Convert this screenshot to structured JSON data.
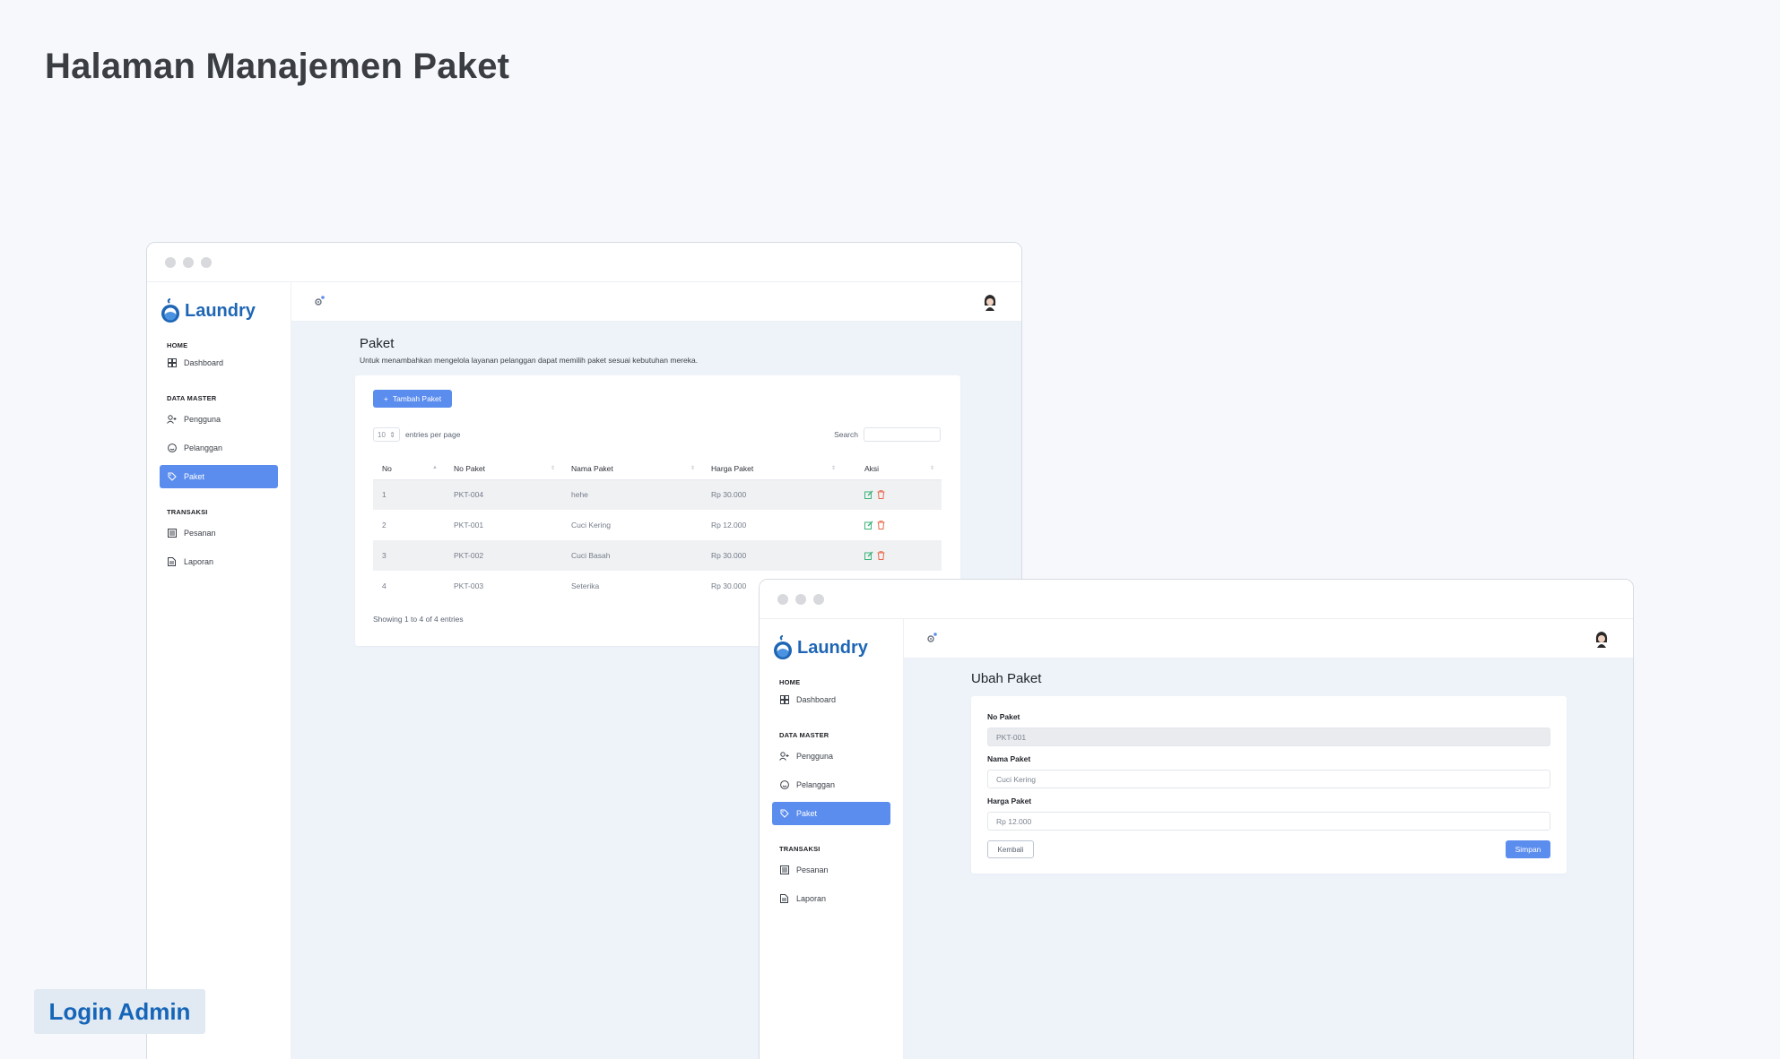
{
  "page": {
    "title": "Halaman Manajemen Paket",
    "badge": "Login Admin"
  },
  "brand": {
    "name": "Laundry",
    "color": "#1e66b5",
    "accent": "#5b8def"
  },
  "sidebar": {
    "section_home": "HOME",
    "section_master": "DATA MASTER",
    "section_transaksi": "TRANSAKSI",
    "items": [
      {
        "label": "Dashboard",
        "icon": "dashboard-icon"
      },
      {
        "label": "Pengguna",
        "icon": "user-add-icon"
      },
      {
        "label": "Pelanggan",
        "icon": "smile-icon"
      },
      {
        "label": "Paket",
        "icon": "tag-icon",
        "active": true
      },
      {
        "label": "Pesanan",
        "icon": "list-icon"
      },
      {
        "label": "Laporan",
        "icon": "file-icon"
      }
    ]
  },
  "list_view": {
    "title": "Paket",
    "description": "Untuk menambahkan mengelola layanan pelanggan dapat memilih paket sesuai kebutuhan mereka.",
    "add_button": "Tambah Paket",
    "entries_value": "10",
    "entries_label": "entries per page",
    "search_label": "Search",
    "columns": [
      "No",
      "No Paket",
      "Nama Paket",
      "Harga Paket",
      "Aksi"
    ],
    "rows": [
      [
        "1",
        "PKT-004",
        "hehe",
        "Rp 30.000"
      ],
      [
        "2",
        "PKT-001",
        "Cuci Kering",
        "Rp 12.000"
      ],
      [
        "3",
        "PKT-002",
        "Cuci Basah",
        "Rp 30.000"
      ],
      [
        "4",
        "PKT-003",
        "Seterika",
        "Rp 30.000"
      ]
    ],
    "showing": "Showing 1 to 4 of 4 entries"
  },
  "edit_view": {
    "title": "Ubah Paket",
    "field_no_label": "No Paket",
    "field_no_value": "PKT-001",
    "field_nama_label": "Nama Paket",
    "field_nama_value": "Cuci Kering",
    "field_harga_label": "Harga Paket",
    "field_harga_value": "Rp 12.000",
    "back_button": "Kembali",
    "save_button": "Simpan"
  }
}
